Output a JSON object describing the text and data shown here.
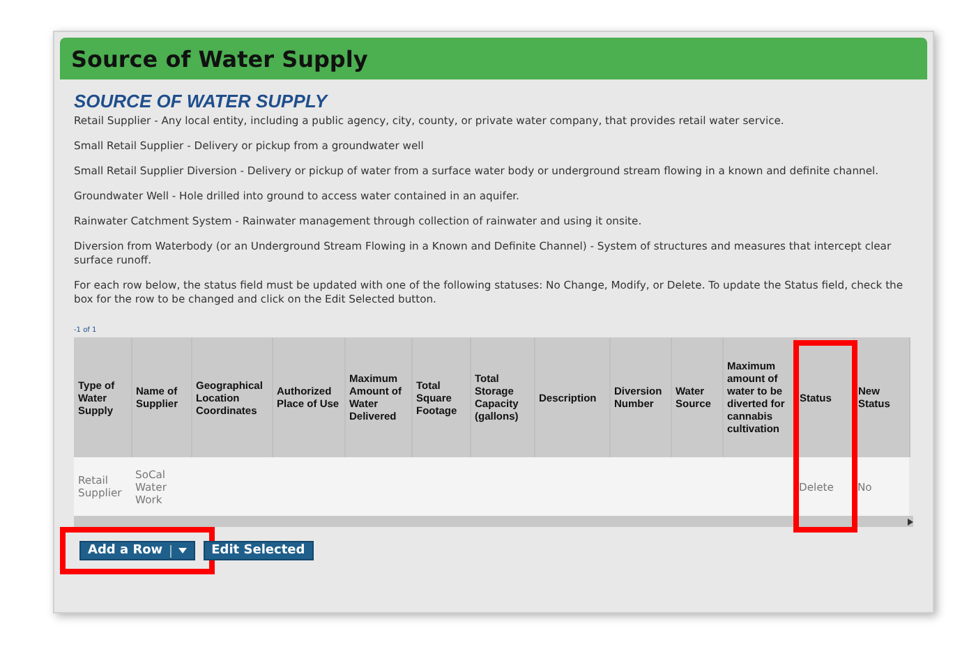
{
  "panel": {
    "title": "Source of Water Supply"
  },
  "section": {
    "heading": "SOURCE OF WATER SUPPLY",
    "paragraphs": [
      "Retail Supplier - Any local entity, including a public agency, city, county, or private water company, that provides retail water service.",
      "Small Retail Supplier - Delivery or pickup from a groundwater well",
      "Small Retail Supplier Diversion - Delivery or pickup of water from a surface water body or underground stream flowing in a known and definite channel.",
      "Groundwater Well - Hole drilled into ground to access water contained in an aquifer.",
      "Rainwater Catchment System - Rainwater management through collection of rainwater and using it onsite.",
      "Diversion from Waterbody (or an Underground Stream Flowing in a Known and Definite Channel) - System of structures and measures that intercept clear surface runoff.",
      "For each row below, the status field must be updated with one of the following statuses: No Change, Modify, or Delete. To update the Status field, check the box for the row to be changed and click on the Edit Selected button."
    ]
  },
  "table": {
    "pagination": "-1 of 1",
    "columns": [
      {
        "label": "Type of Water Supply",
        "highlighted": false
      },
      {
        "label": "Name of Supplier",
        "highlighted": false
      },
      {
        "label": "Geographical Location Coordinates",
        "highlighted": false
      },
      {
        "label": "Authorized Place of Use",
        "highlighted": false
      },
      {
        "label": "Maximum Amount of Water Delivered",
        "highlighted": false
      },
      {
        "label": "Total Square Footage",
        "highlighted": false
      },
      {
        "label": "Total Storage Capacity (gallons)",
        "highlighted": false
      },
      {
        "label": "Description",
        "highlighted": false
      },
      {
        "label": "Diversion Number",
        "highlighted": false
      },
      {
        "label": "Water Source",
        "highlighted": false
      },
      {
        "label": "Maximum amount of water to be diverted for cannabis cultivation",
        "highlighted": false
      },
      {
        "label": "Status",
        "highlighted": true
      },
      {
        "label": "New Status",
        "highlighted": false
      }
    ],
    "rows": [
      [
        "Retail Supplier",
        "SoCal Water Work",
        "",
        "",
        "",
        "",
        "",
        "",
        "",
        "",
        "",
        "Delete",
        "No"
      ]
    ]
  },
  "actions": [
    {
      "label": "Add a Row",
      "kind": "split",
      "highlighted": true
    },
    {
      "label": "Edit Selected",
      "kind": "plain",
      "highlighted": false
    }
  ]
}
